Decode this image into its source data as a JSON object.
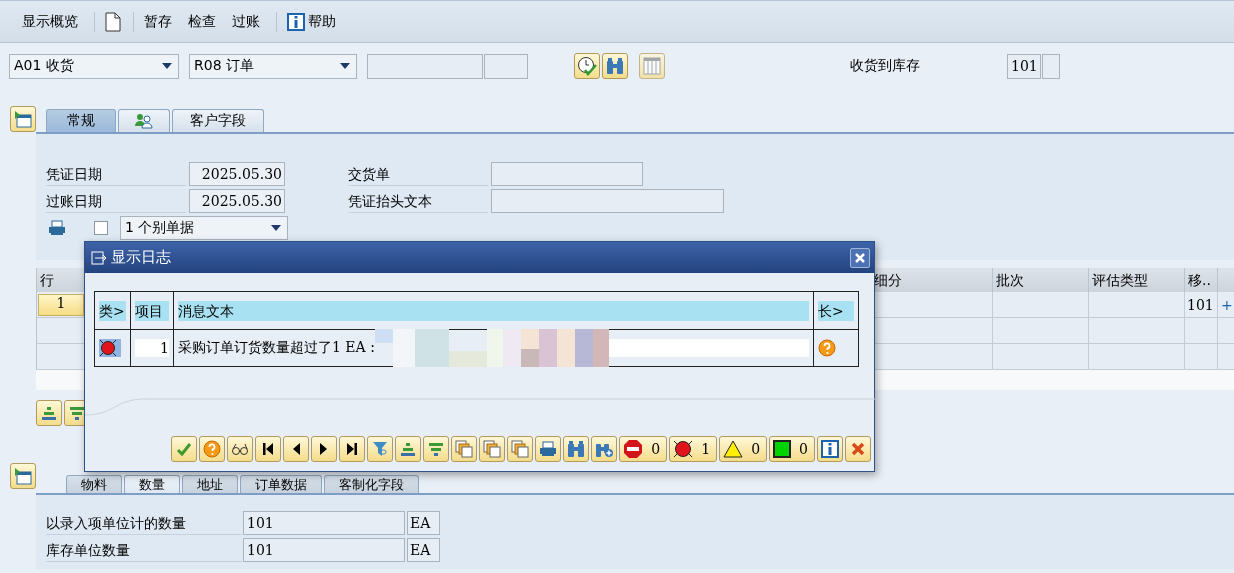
{
  "toolbar": {
    "items": [
      {
        "kind": "text",
        "label": "显示概览"
      },
      {
        "kind": "separator"
      },
      {
        "kind": "new"
      },
      {
        "kind": "separator"
      },
      {
        "kind": "text",
        "label": "暂存"
      },
      {
        "kind": "text",
        "label": "检查"
      },
      {
        "kind": "text",
        "label": "过账"
      },
      {
        "kind": "separator"
      },
      {
        "kind": "help",
        "label": "帮助"
      }
    ]
  },
  "selection": {
    "action": "A01 收货",
    "reference": "R08 订单",
    "movement_label": "收货到库存",
    "movement_type": "101"
  },
  "header_tabs": [
    {
      "kind": "text",
      "label": "常规",
      "selected": true
    },
    {
      "kind": "partners",
      "selected": false
    },
    {
      "kind": "text",
      "label": "客户字段",
      "selected": false
    }
  ],
  "header_fields": {
    "doc_date_label": "凭证日期",
    "doc_date": "2025.05.30",
    "posting_date_label": "过账日期",
    "posting_date": "2025.05.30",
    "delivery_note_label": "交货单",
    "header_text_label": "凭证抬头文本",
    "print_checked": false,
    "print_option": "1 个别单据"
  },
  "items_table": {
    "columns": [
      "行",
      "细分",
      "批次",
      "评估类型",
      "移.."
    ],
    "rows": [
      {
        "line": "1",
        "movement_type": "101",
        "extra": "+"
      }
    ]
  },
  "detail_tabs": [
    {
      "label": "物料",
      "selected": false
    },
    {
      "label": "数量",
      "selected": true
    },
    {
      "label": "地址",
      "selected": false
    },
    {
      "label": "订单数据",
      "selected": false
    },
    {
      "label": "客制化字段",
      "selected": false
    }
  ],
  "detail_fields": [
    {
      "label": "以录入项单位计的数量",
      "value": "101",
      "unit": "EA"
    },
    {
      "label": "库存单位数量",
      "value": "101",
      "unit": "EA"
    }
  ],
  "dialog": {
    "title": "显示日志",
    "columns": [
      "类>",
      "项目",
      "消息文本",
      "长>"
    ],
    "messages": [
      {
        "kind": "error",
        "item": "1",
        "text": "采购订单订货数量超过了1 EA :"
      }
    ],
    "counts": [
      {
        "kind": "stop",
        "count": "0"
      },
      {
        "kind": "error",
        "count": "1"
      },
      {
        "kind": "warning",
        "count": "0"
      },
      {
        "kind": "success",
        "count": "0"
      }
    ]
  }
}
